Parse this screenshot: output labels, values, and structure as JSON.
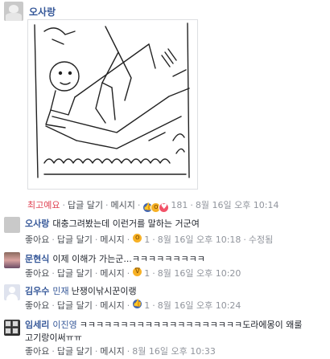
{
  "top_comment": {
    "author": "오사랑",
    "actions": {
      "like": "최고예요",
      "reply": "답글 달기",
      "message": "메시지",
      "reaction_count": "181",
      "time": "8월 16일 오후 10:14"
    },
    "reaction_icons": [
      "like-icon",
      "wow-icon",
      "love-icon"
    ]
  },
  "replies": [
    {
      "author": "오사랑",
      "tag": "",
      "text": "대충그려봤는데 이런거를 말하는 거군여",
      "actions": {
        "like": "좋아요",
        "reply": "답글 달기",
        "message": "메시지",
        "reaction_count": "1",
        "time": "8월 16일 오후 10:18",
        "edited": "수정됨"
      },
      "reaction_icon": "wow-icon"
    },
    {
      "author": "문현식",
      "tag": "",
      "text": "이제 이해가 가는군...ㅋㅋㅋㅋㅋㅋㅋㅋㅋ",
      "actions": {
        "like": "좋아요",
        "reply": "답글 달기",
        "message": "메시지",
        "reaction_count": "1",
        "time": "8월 16일 오후 10:20"
      },
      "reaction_icon": "haha-icon"
    },
    {
      "author": "김우수",
      "tag": "민재",
      "text": "난쟁이낚시꾼이랭",
      "actions": {
        "like": "좋아요",
        "reply": "답글 달기",
        "message": "메시지",
        "reaction_count": "1",
        "time": "8월 16일 오후 10:24"
      },
      "reaction_icon": "like-icon"
    },
    {
      "author": "임세리",
      "tag": "이진영",
      "text": "ㅋㅋㅋㅋㅋㅋㅋㅋㅋㅋㅋㅋㅋㅋㅋㅋㅋㅋㅋㅋ도라에몽이 왜룰",
      "text2": "고기랑이써ㅠㅠ",
      "actions": {
        "like": "좋아요",
        "reply": "답글 달기",
        "message": "메시지",
        "time": "8월 16일 오후 10:33"
      }
    }
  ]
}
